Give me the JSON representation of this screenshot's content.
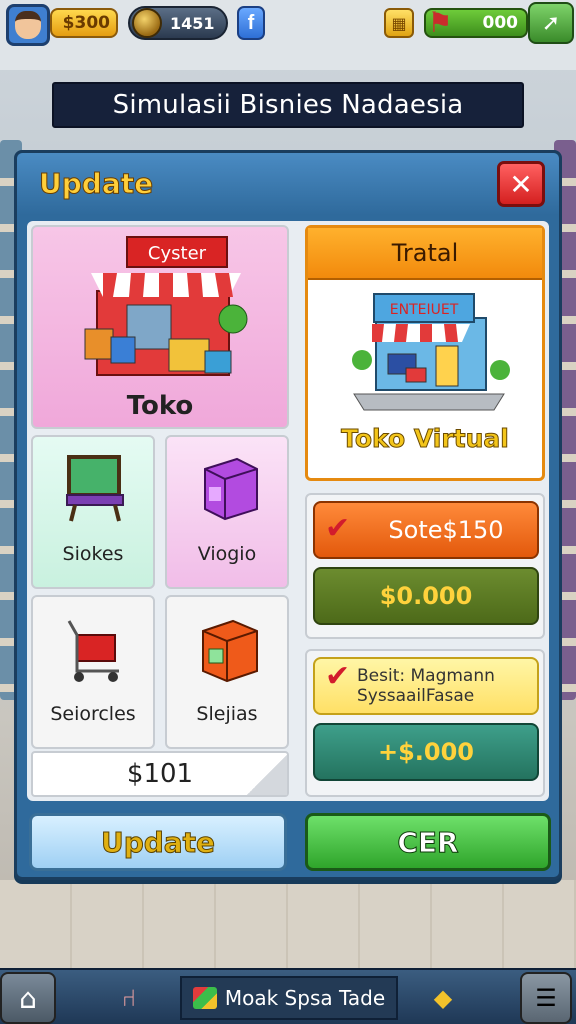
{
  "topbar": {
    "coins": "$300",
    "gems": "1451",
    "facebook_icon": "f",
    "xp_value": "000"
  },
  "title": "Simulasii Bisnies Nadaesia",
  "panel": {
    "title": "Update",
    "close_icon": "✕"
  },
  "shop_card": {
    "sign": "Cyster",
    "label": "Toko"
  },
  "items": [
    {
      "label": "Siokes"
    },
    {
      "label": "Viogio"
    },
    {
      "label": "Seiorcles"
    },
    {
      "label": "Slejias"
    }
  ],
  "price": "$101",
  "virtual_card": {
    "header": "Tratal",
    "sign": "ENTEIUET",
    "label": "Toko Virtual"
  },
  "offers": {
    "sote_label": "Sote$150",
    "green_price": "$0.000",
    "best_label_line1": "Besit: Magmann",
    "best_label_line2": "SyssaailFasae",
    "teal_price": "+$.000"
  },
  "buttons": {
    "update": "Update",
    "cer": "CER"
  },
  "bottom_nav": {
    "main_label": "Moak Spsa Tade"
  },
  "colors": {
    "accent_orange": "#f28a0c",
    "accent_green": "#2fa52b",
    "close_red": "#d42020",
    "panel_blue": "#2f6a9c"
  }
}
